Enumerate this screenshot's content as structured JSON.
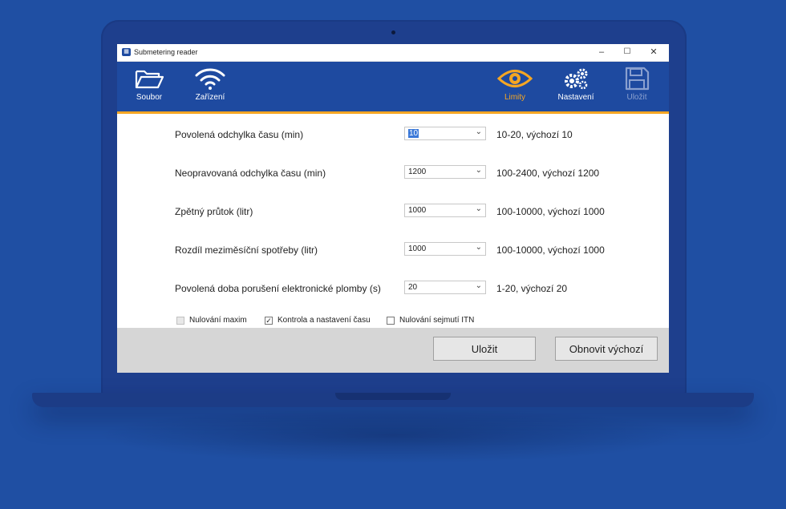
{
  "window": {
    "title": "Submetering reader"
  },
  "window_controls": {
    "minimize": "–",
    "maximize": "☐",
    "close": "✕"
  },
  "toolbar": {
    "file": "Soubor",
    "device": "Zařízení",
    "limits": "Limity",
    "settings": "Nastavení",
    "save": "Uložit",
    "accent_color": "#f5a623",
    "bar_color": "#1e4aa0"
  },
  "fields": [
    {
      "label": "Povolená odchylka času (min)",
      "value": "10",
      "hint": "10-20, výchozí 10"
    },
    {
      "label": "Neopravovaná odchylka času (min)",
      "value": "1200",
      "hint": "100-2400, výchozí 1200"
    },
    {
      "label": "Zpětný průtok (litr)",
      "value": "1000",
      "hint": "100-10000, výchozí 1000"
    },
    {
      "label": "Rozdíl meziměsíční spotřeby (litr)",
      "value": "1000",
      "hint": "100-10000, výchozí 1000"
    },
    {
      "label": "Povolená doba porušení elektronické plomby (s)",
      "value": "20",
      "hint": "1-20, výchozí 20"
    }
  ],
  "checkboxes": [
    {
      "label": "Nulování maxim",
      "checked": false,
      "disabled": true
    },
    {
      "label": "Kontrola a nastavení času",
      "checked": true,
      "disabled": false
    },
    {
      "label": "Nulování sejmutí ITN",
      "checked": false,
      "disabled": false
    }
  ],
  "footer": {
    "save": "Uložit",
    "restore": "Obnovit výchozí"
  },
  "icons": {
    "file": "folder-open-icon",
    "device": "wifi-icon",
    "limits": "eye-icon",
    "settings": "gears-icon",
    "save": "floppy-disk-icon"
  }
}
